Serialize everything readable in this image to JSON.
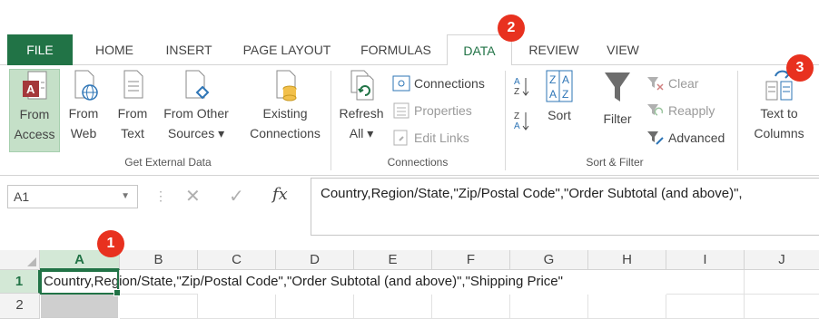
{
  "tabs": [
    {
      "label": "FILE"
    },
    {
      "label": "HOME"
    },
    {
      "label": "INSERT"
    },
    {
      "label": "PAGE LAYOUT"
    },
    {
      "label": "FORMULAS"
    },
    {
      "label": "DATA"
    },
    {
      "label": "REVIEW"
    },
    {
      "label": "VIEW"
    }
  ],
  "ribbon": {
    "get_external_data": {
      "buttons": [
        {
          "line1": "From",
          "line2": "Access",
          "icon": "access-icon"
        },
        {
          "line1": "From",
          "line2": "Web",
          "icon": "web-icon"
        },
        {
          "line1": "From",
          "line2": "Text",
          "icon": "text-file-icon"
        },
        {
          "line1": "From Other",
          "line2": "Sources ▾",
          "icon": "other-sources-icon"
        },
        {
          "line1": "Existing",
          "line2": "Connections",
          "icon": "existing-connections-icon"
        }
      ],
      "label": "Get External Data"
    },
    "connections": {
      "refresh_line1": "Refresh",
      "refresh_line2": "All ▾",
      "connections_label": "Connections",
      "properties_label": "Properties",
      "edit_links_label": "Edit Links",
      "label": "Connections"
    },
    "sort_filter": {
      "sort_label": "Sort",
      "filter_label": "Filter",
      "clear_label": "Clear",
      "reapply_label": "Reapply",
      "advanced_label": "Advanced",
      "label": "Sort & Filter"
    },
    "data_tools": {
      "text_to_columns_line1": "Text to",
      "text_to_columns_line2": "Columns"
    }
  },
  "formula_bar": {
    "name_box": "A1",
    "fx": "fx",
    "content": "Country,Region/State,\"Zip/Postal Code\",\"Order Subtotal (and above)\","
  },
  "grid": {
    "columns": [
      "A",
      "B",
      "C",
      "D",
      "E",
      "F",
      "G",
      "H",
      "I",
      "J"
    ],
    "rows": [
      "1",
      "2"
    ],
    "cell_a1": "Country,Region/State,\"Zip/Postal Code\",\"Order Subtotal (and above)\",\"Shipping Price\""
  },
  "callouts": [
    "1",
    "2",
    "3"
  ],
  "colors": {
    "accent": "#217346",
    "callout": "#e8311f"
  }
}
